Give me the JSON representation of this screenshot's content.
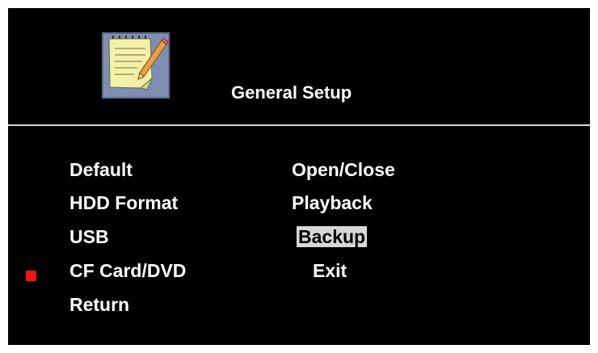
{
  "header": {
    "title": "General Setup",
    "icon": "notepad-pencil-icon"
  },
  "menu": {
    "left": [
      "Default",
      "HDD Format",
      "USB",
      "CF Card/DVD",
      "Return"
    ],
    "right": [
      "Open/Close",
      "Playback",
      "Backup",
      "Exit"
    ],
    "active_left": "CF Card/DVD",
    "selected_right": "Backup"
  },
  "colors": {
    "background": "#000000",
    "text": "#ffffff",
    "selection_bg": "#d7d7d7",
    "marker": "#ff1010"
  }
}
